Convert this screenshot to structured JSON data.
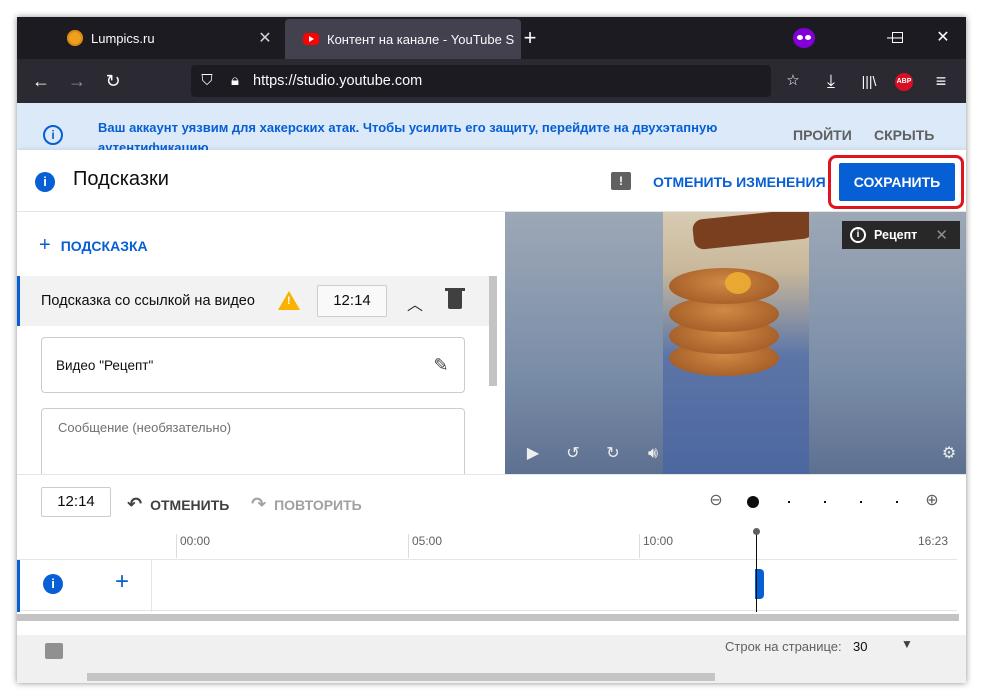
{
  "browser": {
    "tabs": [
      {
        "label": "Lumpics.ru",
        "favicon": "lumpics-orange-circle-icon",
        "active": false
      },
      {
        "label": "Контент на канале - YouTube S",
        "favicon": "youtube-icon",
        "active": true
      }
    ],
    "new_tab": "+",
    "url": "https://studio.youtube.com",
    "toolbar_icons": [
      "back-arrow-icon",
      "forward-arrow-icon",
      "reload-icon",
      "shield-icon",
      "lock-icon",
      "star-icon",
      "download-icon",
      "library-icon",
      "adblock-icon",
      "menu-icon"
    ],
    "abp_label": "ABP"
  },
  "banner": {
    "message": "Ваш аккаунт уязвим для хакерских атак. Чтобы усилить его защиту, перейдите на двухэтапную аутентификацию.",
    "go_label": "ПРОЙТИ",
    "hide_label": "СКРЫТЬ"
  },
  "modal": {
    "title": "Подсказки",
    "undo_changes_label": "ОТМЕНИТЬ ИЗМЕНЕНИЯ",
    "save_label": "СОХРАНИТЬ",
    "add_card_label": "ПОДСКАЗКА",
    "card": {
      "title": "Подсказка со ссылкой на видео",
      "time": "12:14",
      "video_label": "Видео \"Рецепт\"",
      "message_placeholder": "Сообщение (необязательно)"
    },
    "preview": {
      "chip_label": "Рецепт"
    },
    "timeline": {
      "time": "12:14",
      "undo_label": "ОТМЕНИТЬ",
      "redo_label": "ПОВТОРИТЬ",
      "ticks": [
        "00:00",
        "05:00",
        "10:00",
        "16:23"
      ]
    }
  },
  "background_page": {
    "rows_per_page_label": "Строк на странице:",
    "rows_per_page_value": "30"
  },
  "colors": {
    "accent": "#065fd4",
    "highlight": "#e0141e",
    "warning": "#f9b200",
    "browser_bg": "#1c1b22"
  }
}
